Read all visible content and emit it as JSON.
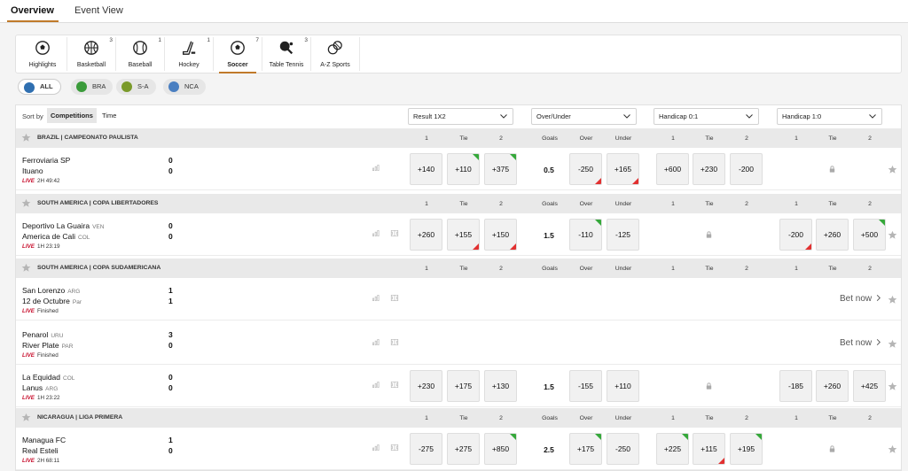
{
  "top_tabs": [
    "Overview",
    "Event View"
  ],
  "sports": [
    {
      "label": "Highlights",
      "count": "",
      "icon": "soccer-ball-icon"
    },
    {
      "label": "Basketball",
      "count": "3",
      "icon": "basketball-icon"
    },
    {
      "label": "Baseball",
      "count": "1",
      "icon": "baseball-icon"
    },
    {
      "label": "Hockey",
      "count": "1",
      "icon": "hockey-stick-icon"
    },
    {
      "label": "Soccer",
      "count": "7",
      "icon": "soccer-ball-icon"
    },
    {
      "label": "Table Tennis",
      "count": "3",
      "icon": "table-tennis-icon"
    },
    {
      "label": "A-Z Sports",
      "count": "",
      "icon": "multi-sport-icon"
    }
  ],
  "regions": [
    "ALL",
    "BRA",
    "S-A",
    "NCA"
  ],
  "sort": {
    "label": "Sort by",
    "options": [
      "Competitions",
      "Time"
    ]
  },
  "markets": [
    "Result 1X2",
    "Over/Under",
    "Handicap 0:1",
    "Handicap 1:0"
  ],
  "columns": {
    "result": [
      "1",
      "Tie",
      "2"
    ],
    "ou": [
      "Goals",
      "Over",
      "Under"
    ],
    "h01": [
      "1",
      "Tie",
      "2"
    ],
    "h10": [
      "1",
      "Tie",
      "2"
    ]
  },
  "live_label": "LIVE",
  "bet_now_label": "Bet now",
  "colors": {
    "accent": "#c07a2a",
    "live": "#c8102e",
    "up": "#35a83a",
    "down": "#e23030"
  },
  "leagues": [
    {
      "name": "BRAZIL | CAMPEONATO PAULISTA",
      "matches": [
        {
          "home": "Ferroviaria SP",
          "home_cc": "",
          "away": "Ituano",
          "away_cc": "",
          "home_score": "0",
          "away_score": "0",
          "status": "2H 49:42",
          "result": [
            {
              "v": "+140",
              "t": ""
            },
            {
              "v": "+110",
              "t": "up"
            },
            {
              "v": "+375",
              "t": "up"
            }
          ],
          "goals": "0.5",
          "ou": [
            {
              "v": "-250",
              "t": "down"
            },
            {
              "v": "+165",
              "t": "down"
            }
          ],
          "h01": [
            {
              "v": "+600",
              "t": ""
            },
            {
              "v": "+230",
              "t": ""
            },
            {
              "v": "-200",
              "t": ""
            }
          ],
          "h10": null
        }
      ]
    },
    {
      "name": "SOUTH AMERICA | COPA LIBERTADORES",
      "matches": [
        {
          "home": "Deportivo La Guaira",
          "home_cc": "VEN",
          "away": "America de Cali",
          "away_cc": "COL",
          "home_score": "0",
          "away_score": "0",
          "status": "1H 23:19",
          "result": [
            {
              "v": "+260",
              "t": ""
            },
            {
              "v": "+155",
              "t": "down"
            },
            {
              "v": "+150",
              "t": "down"
            }
          ],
          "goals": "1.5",
          "ou": [
            {
              "v": "-110",
              "t": "up"
            },
            {
              "v": "-125",
              "t": ""
            }
          ],
          "h01": null,
          "h10": [
            {
              "v": "-200",
              "t": "down"
            },
            {
              "v": "+260",
              "t": ""
            },
            {
              "v": "+500",
              "t": "up"
            }
          ]
        }
      ]
    },
    {
      "name": "SOUTH AMERICA | COPA SUDAMERICANA",
      "matches": [
        {
          "home": "San Lorenzo",
          "home_cc": "ARG",
          "away": "12 de Octubre",
          "away_cc": "Par",
          "home_score": "1",
          "away_score": "1",
          "status": "Finished",
          "betnow": true
        },
        {
          "home": "Penarol",
          "home_cc": "URU",
          "away": "River Plate",
          "away_cc": "PAR",
          "home_score": "3",
          "away_score": "0",
          "status": "Finished",
          "betnow": true
        },
        {
          "home": "La Equidad",
          "home_cc": "COL",
          "away": "Lanus",
          "away_cc": "ARG",
          "home_score": "0",
          "away_score": "0",
          "status": "1H 23:22",
          "result": [
            {
              "v": "+230",
              "t": ""
            },
            {
              "v": "+175",
              "t": ""
            },
            {
              "v": "+130",
              "t": ""
            }
          ],
          "goals": "1.5",
          "ou": [
            {
              "v": "-155",
              "t": ""
            },
            {
              "v": "+110",
              "t": ""
            }
          ],
          "h01": null,
          "h10": [
            {
              "v": "-185",
              "t": ""
            },
            {
              "v": "+260",
              "t": ""
            },
            {
              "v": "+425",
              "t": ""
            }
          ]
        }
      ]
    },
    {
      "name": "NICARAGUA | LIGA PRIMERA",
      "matches": [
        {
          "home": "Managua FC",
          "home_cc": "",
          "away": "Real Esteli",
          "away_cc": "",
          "home_score": "1",
          "away_score": "0",
          "status": "2H 68:11",
          "result": [
            {
              "v": "-275",
              "t": ""
            },
            {
              "v": "+275",
              "t": ""
            },
            {
              "v": "+850",
              "t": "up"
            }
          ],
          "goals": "2.5",
          "ou": [
            {
              "v": "+175",
              "t": "up"
            },
            {
              "v": "-250",
              "t": ""
            }
          ],
          "h01": [
            {
              "v": "+225",
              "t": "up"
            },
            {
              "v": "+115",
              "t": "down"
            },
            {
              "v": "+195",
              "t": "up"
            }
          ],
          "h10": null
        }
      ]
    }
  ]
}
